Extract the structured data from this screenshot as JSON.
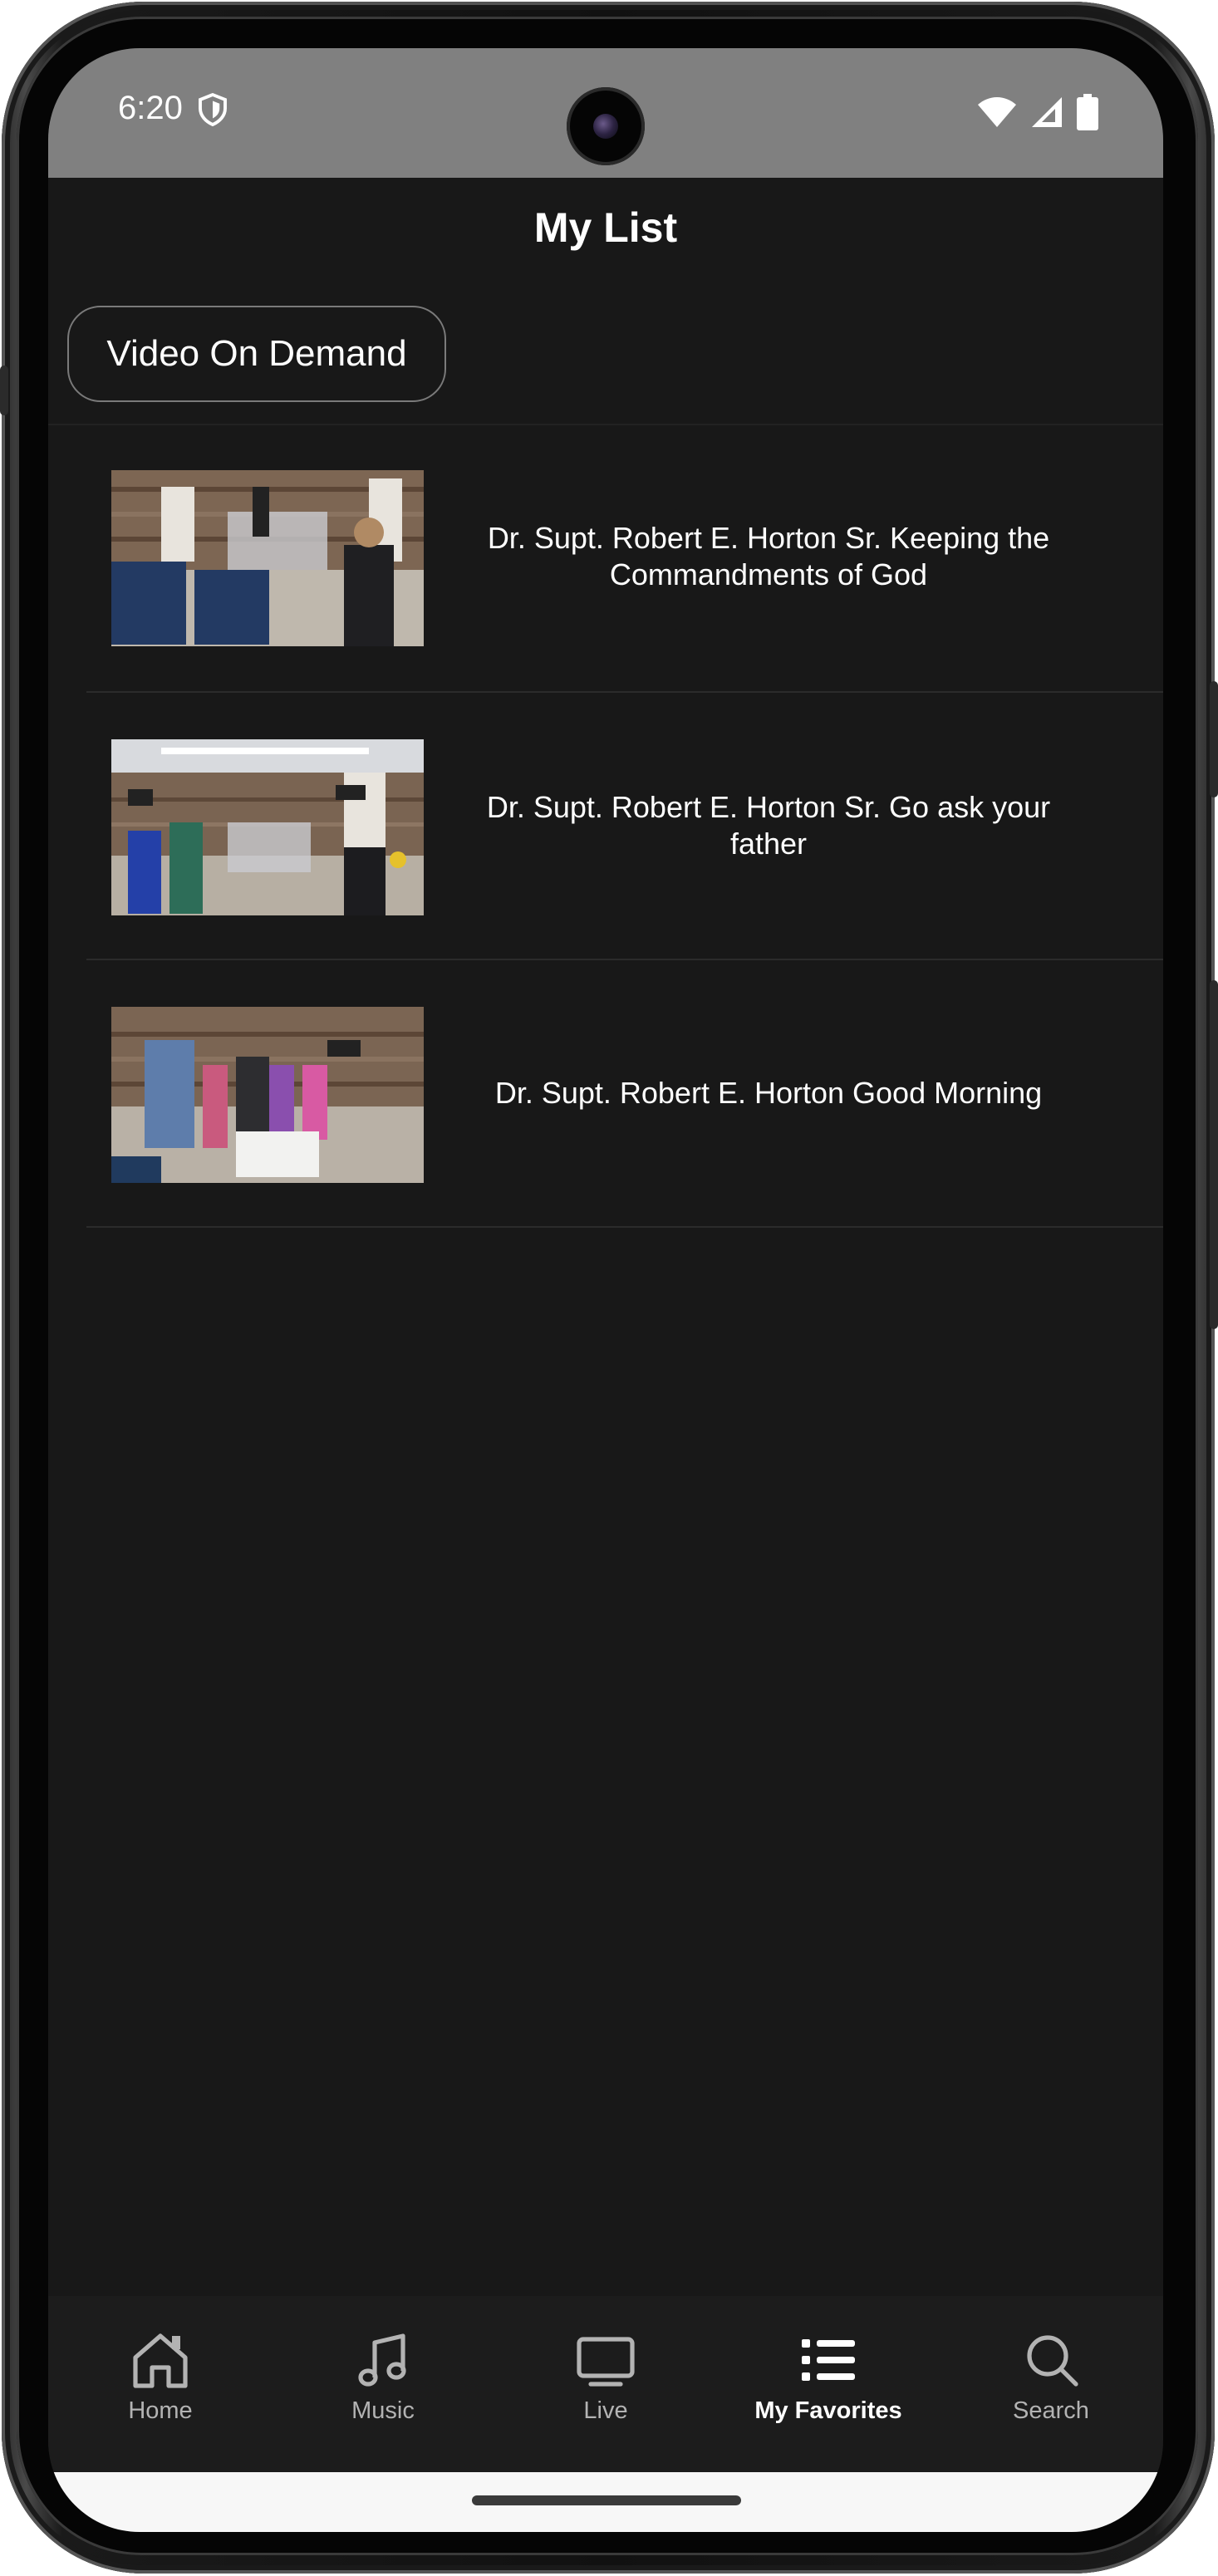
{
  "status_bar": {
    "time": "6:20",
    "icons": [
      "shield-icon",
      "wifi-icon",
      "cell-signal-icon",
      "battery-icon"
    ]
  },
  "header": {
    "title": "My List"
  },
  "category_chip": {
    "label": "Video On Demand"
  },
  "items": [
    {
      "title": "Dr. Supt. Robert E. Horton Sr. Keeping the Commandments of God"
    },
    {
      "title": "Dr. Supt. Robert E. Horton Sr. Go ask your father"
    },
    {
      "title": "Dr. Supt. Robert E. Horton Good Morning"
    }
  ],
  "bottom_nav": {
    "active": "My Favorites",
    "items": [
      {
        "label": "Home",
        "icon": "home-icon"
      },
      {
        "label": "Music",
        "icon": "music-note-icon"
      },
      {
        "label": "Live",
        "icon": "tv-icon"
      },
      {
        "label": "My Favorites",
        "icon": "list-icon"
      },
      {
        "label": "Search",
        "icon": "search-icon"
      }
    ]
  },
  "colors": {
    "background": "#181818",
    "status_bar": "#808080",
    "nav_background": "#1c1c1c",
    "text": "#ffffff",
    "inactive_nav": "#b3b3b3"
  }
}
